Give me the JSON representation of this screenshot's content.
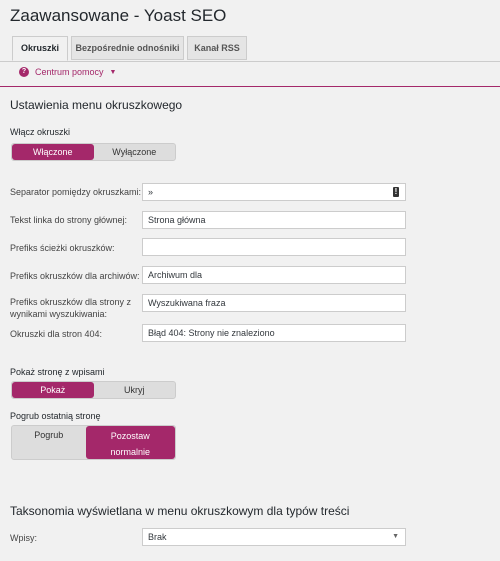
{
  "page": {
    "title": "Zaawansowane - Yoast SEO"
  },
  "tabs": [
    {
      "label": "Okruszki"
    },
    {
      "label": "Bezpośrednie odnośniki"
    },
    {
      "label": "Kanał RSS"
    }
  ],
  "help": {
    "label": "Centrum pomocy",
    "icon": "question-circle-icon"
  },
  "section1": {
    "heading": "Ustawienia menu okruszkowego",
    "enable": {
      "label": "Włącz okruszki",
      "on": "Włączone",
      "off": "Wyłączone"
    },
    "fields": [
      {
        "label": "Separator pomiędzy okruszkami:",
        "value": "»"
      },
      {
        "label": "Tekst linka do strony głównej:",
        "value": "Strona główna"
      },
      {
        "label": "Prefiks ścieżki okruszków:",
        "value": ""
      },
      {
        "label": "Prefiks okruszków dla archiwów:",
        "value": "Archiwum dla"
      },
      {
        "label": "Prefiks okruszków dla strony z wynikami wyszukiwania:",
        "value": "Wyszukiwana fraza"
      },
      {
        "label": "Okruszki dla stron 404:",
        "value": "Błąd 404: Strony nie znaleziono"
      }
    ],
    "show_blog": {
      "label": "Pokaż stronę z wpisami",
      "on": "Pokaż",
      "off": "Ukryj"
    },
    "bold_last": {
      "label": "Pogrub ostatnią stronę",
      "bold": "Pogrub",
      "normal": "Pozostaw normalnie"
    }
  },
  "section2": {
    "heading": "Taksonomia wyświetlana w menu okruszkowym dla typów treści",
    "posts": {
      "label": "Wpisy:",
      "value": "Brak"
    }
  },
  "colors": {
    "accent": "#a4286a"
  }
}
